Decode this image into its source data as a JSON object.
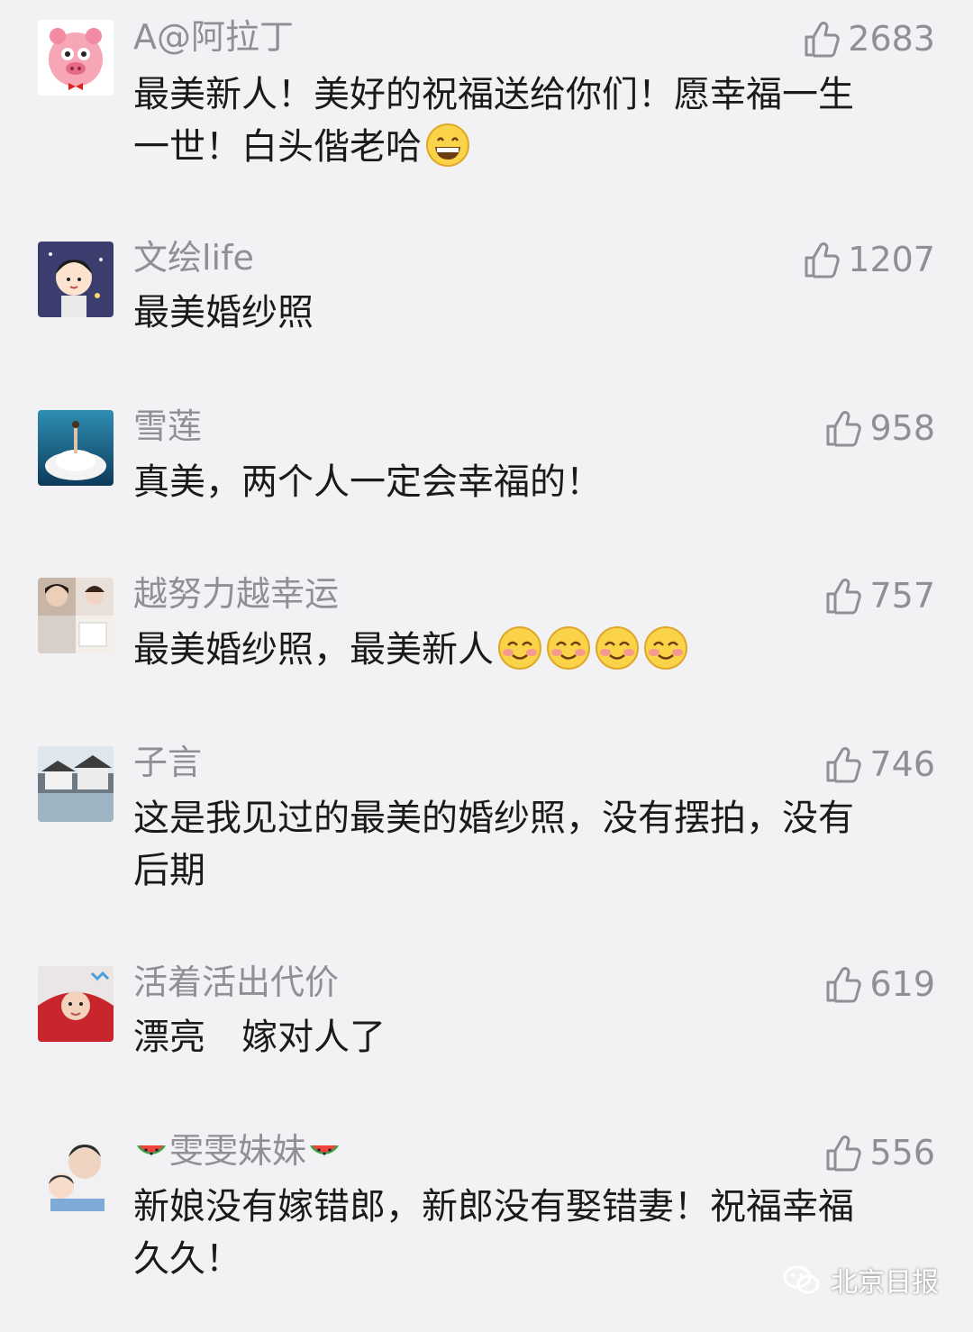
{
  "comments": [
    {
      "name": "A@阿拉丁",
      "likes": "2683",
      "text_lines": [
        "最美新人！美好的祝福送给你们！愿幸福一生",
        "一世！白头偕老哈"
      ]
    },
    {
      "name": "文绘life",
      "likes": "1207",
      "text": "最美婚纱照"
    },
    {
      "name": "雪莲",
      "likes": "958",
      "text": "真美，两个人一定会幸福的！"
    },
    {
      "name": "越努力越幸运",
      "likes": "757",
      "text": "最美婚纱照，最美新人"
    },
    {
      "name": "子言",
      "likes": "746",
      "text_lines": [
        "这是我见过的最美的婚纱照，没有摆拍，没有",
        "后期"
      ]
    },
    {
      "name": "活着活出代价",
      "likes": "619",
      "text": "漂亮　嫁对人了"
    },
    {
      "name": "雯雯妹妹",
      "likes": "556",
      "text_lines": [
        "新娘没有嫁错郎，新郎没有娶错妻！祝福幸福",
        "久久！"
      ]
    }
  ],
  "watermark": {
    "label": "北京日报"
  },
  "icons": {
    "like": "thumbs-up-icon",
    "grin": "grinning-face-emoji",
    "blush": "smiling-blush-emoji",
    "melon": "watermelon-emoji",
    "wechat": "wechat-logo-icon"
  }
}
